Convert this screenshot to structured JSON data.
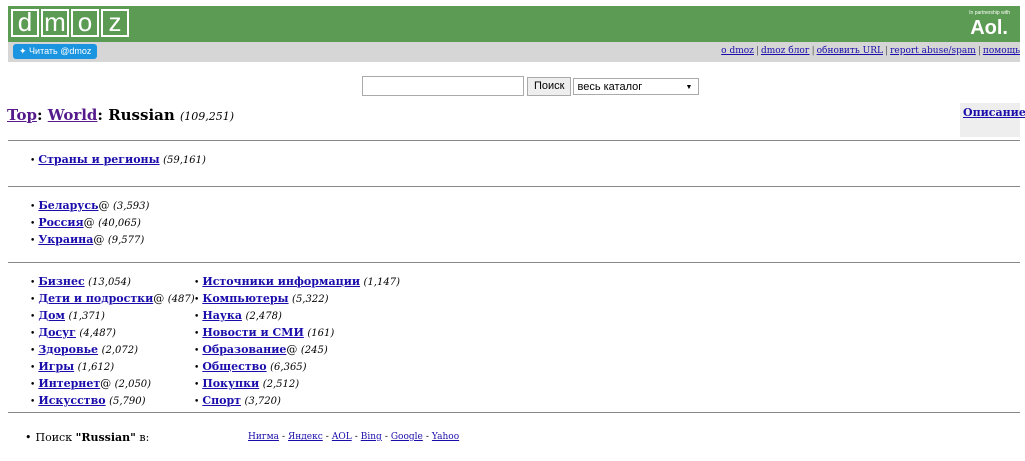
{
  "header": {
    "logo_letters": [
      "d",
      "m",
      "o",
      "z"
    ],
    "partner_tag": "In partnership with",
    "partner_name": "Aol."
  },
  "subbar": {
    "twitter_button": "Читать @dmoz",
    "links": [
      "о dmoz",
      "dmoz блог",
      "обновить URL",
      "report abuse/spam",
      "помощь"
    ]
  },
  "search": {
    "value": "",
    "button": "Поиск",
    "scope": "весь каталог"
  },
  "breadcrumb": {
    "top": "Top",
    "world": "World",
    "current": "Russian",
    "count": "(109,251)"
  },
  "description_link": "Описание",
  "sections": {
    "regions": [
      {
        "label": "Страны и регионы",
        "suffix": "",
        "count": "(59,161)"
      }
    ],
    "countries": [
      {
        "label": "Беларусь",
        "suffix": "@",
        "count": "(3,593)"
      },
      {
        "label": "Россия",
        "suffix": "@",
        "count": "(40,065)"
      },
      {
        "label": "Украина",
        "suffix": "@",
        "count": "(9,577)"
      }
    ],
    "col1": [
      {
        "label": "Бизнес",
        "suffix": "",
        "count": "(13,054)"
      },
      {
        "label": "Дети и подростки",
        "suffix": "@",
        "count": "(487)"
      },
      {
        "label": "Дом",
        "suffix": "",
        "count": "(1,371)"
      },
      {
        "label": "Досуг",
        "suffix": "",
        "count": "(4,487)"
      },
      {
        "label": "Здоровье",
        "suffix": "",
        "count": "(2,072)"
      },
      {
        "label": "Игры",
        "suffix": "",
        "count": "(1,612)"
      },
      {
        "label": "Интернет",
        "suffix": "@",
        "count": "(2,050)"
      },
      {
        "label": "Искусство",
        "suffix": "",
        "count": "(5,790)"
      }
    ],
    "col2": [
      {
        "label": "Источники информации",
        "suffix": "",
        "count": "(1,147)"
      },
      {
        "label": "Компьютеры",
        "suffix": "",
        "count": "(5,322)"
      },
      {
        "label": "Наука",
        "suffix": "",
        "count": "(2,478)"
      },
      {
        "label": "Новости и СМИ",
        "suffix": "",
        "count": "(161)"
      },
      {
        "label": "Образование",
        "suffix": "@",
        "count": "(245)"
      },
      {
        "label": "Общество",
        "suffix": "",
        "count": "(6,365)"
      },
      {
        "label": "Покупки",
        "suffix": "",
        "count": "(2,512)"
      },
      {
        "label": "Спорт",
        "suffix": "",
        "count": "(3,720)"
      }
    ]
  },
  "search_elsewhere": {
    "prefix": "Поиск ",
    "term": "\"Russian\"",
    "suffix": " в:",
    "engines": [
      "Нигма",
      "Яндекс",
      "AOL",
      "Bing",
      "Google",
      "Yahoo"
    ]
  }
}
